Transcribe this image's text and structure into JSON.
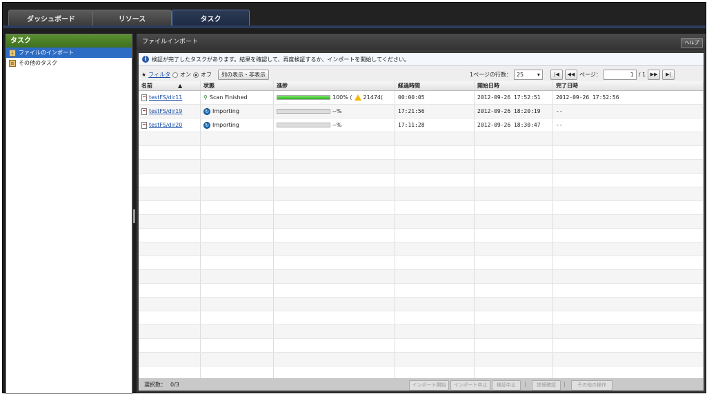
{
  "tabs": [
    "ダッシュボード",
    "リソース",
    "タスク"
  ],
  "left": {
    "title": "タスク",
    "items": [
      {
        "label": "ファイルのインポート",
        "selected": true
      },
      {
        "label": "その他のタスク",
        "selected": false
      }
    ]
  },
  "right": {
    "title": "ファイルインポート",
    "help": "ヘルプ",
    "info": "検証が完了したタスクがあります。結果を確認して、再度検証するか、インポートを開始してください。"
  },
  "toolbar": {
    "filter_prefix": "★",
    "filter": "フィルタ",
    "on": "オン",
    "off": "オフ",
    "columns_button": "列の表示・非表示",
    "rows_label": "1ページの行数：",
    "rows_value": "25",
    "page_label": "ページ：",
    "page_value": "1",
    "page_total": "/ 1"
  },
  "columns": [
    "名前",
    "状態",
    "進捗",
    "経過時間",
    "開始日時",
    "完了日時"
  ],
  "rows": [
    {
      "name": "testFS/dir11",
      "status": "Scan Finished",
      "progress_text": "100% (",
      "warn_text": "21474(",
      "progress": 1.0,
      "elapsed": "00:00:05",
      "start": "2012-09-26 17:52:51",
      "end": "2012-09-26 17:52:56"
    },
    {
      "name": "testFS/dir19",
      "status": "Importing",
      "progress_text": "--%",
      "warn_text": "",
      "progress": 0,
      "elapsed": "17:21:56",
      "start": "2012-09-26 18:20:19",
      "end": "--"
    },
    {
      "name": "testFS/dir20",
      "status": "Importing",
      "progress_text": "--%",
      "warn_text": "",
      "progress": 0,
      "elapsed": "17:11:28",
      "start": "2012-09-26 18:30:47",
      "end": "--"
    }
  ],
  "footer": {
    "selected_label": "選択数：",
    "selected_value": "0/3",
    "buttons": [
      "インポート開始",
      "インポート中止",
      "検証中止",
      "詳細確認",
      "その他の操作"
    ]
  }
}
